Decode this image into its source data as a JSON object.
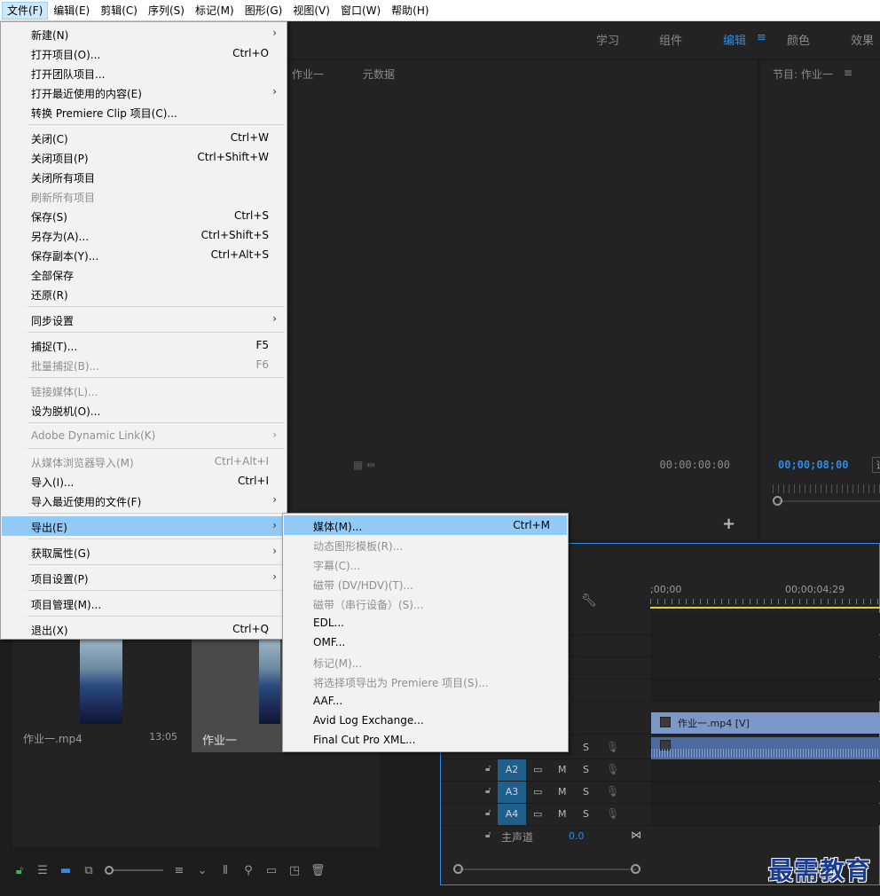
{
  "menubar": {
    "items": [
      "文件(F)",
      "编辑(E)",
      "剪辑(C)",
      "序列(S)",
      "标记(M)",
      "图形(G)",
      "视图(V)",
      "窗口(W)",
      "帮助(H)"
    ]
  },
  "workspace": {
    "tabs": [
      "学习",
      "组件",
      "编辑",
      "颜色",
      "效果"
    ],
    "active_tab": "编辑",
    "menu_icon": "≡"
  },
  "source_panel": {
    "tabs": [
      "作业一",
      "元数据"
    ],
    "timecode": "00:00:00:00"
  },
  "program_panel": {
    "title": "节目: 作业一",
    "menu_icon": "≡",
    "timecode": "00;00;08;00"
  },
  "project_panel": {
    "items": [
      {
        "name": "作业一.mp4",
        "duration": "13;05"
      },
      {
        "name": "作业一",
        "duration": ""
      }
    ]
  },
  "timeline": {
    "ruler_labels": [
      ";00;00",
      "00;00;04;29"
    ],
    "video_clip": "作业一.mp4 [V]",
    "audio_tracks": [
      {
        "name": "A2",
        "m": "M",
        "s": "S"
      },
      {
        "name": "A3",
        "m": "M",
        "s": "S"
      },
      {
        "name": "A4",
        "m": "M",
        "s": "S"
      }
    ],
    "a1_s": "S",
    "master_label": "主声道",
    "master_value": "0.0"
  },
  "file_menu": {
    "items": [
      {
        "label": "新建(N)",
        "shortcut": "",
        "submenu": true,
        "disabled": false
      },
      {
        "label": "打开项目(O)...",
        "shortcut": "Ctrl+O",
        "submenu": false,
        "disabled": false
      },
      {
        "label": "打开团队项目...",
        "shortcut": "",
        "submenu": false,
        "disabled": false
      },
      {
        "label": "打开最近使用的内容(E)",
        "shortcut": "",
        "submenu": true,
        "disabled": false
      },
      {
        "label": "转换 Premiere Clip 项目(C)...",
        "shortcut": "",
        "submenu": false,
        "disabled": false
      },
      {
        "label": "关闭(C)",
        "shortcut": "Ctrl+W",
        "submenu": false,
        "disabled": false
      },
      {
        "label": "关闭项目(P)",
        "shortcut": "Ctrl+Shift+W",
        "submenu": false,
        "disabled": false
      },
      {
        "label": "关闭所有项目",
        "shortcut": "",
        "submenu": false,
        "disabled": false
      },
      {
        "label": "刷新所有项目",
        "shortcut": "",
        "submenu": false,
        "disabled": true
      },
      {
        "label": "保存(S)",
        "shortcut": "Ctrl+S",
        "submenu": false,
        "disabled": false
      },
      {
        "label": "另存为(A)...",
        "shortcut": "Ctrl+Shift+S",
        "submenu": false,
        "disabled": false
      },
      {
        "label": "保存副本(Y)...",
        "shortcut": "Ctrl+Alt+S",
        "submenu": false,
        "disabled": false
      },
      {
        "label": "全部保存",
        "shortcut": "",
        "submenu": false,
        "disabled": false
      },
      {
        "label": "还原(R)",
        "shortcut": "",
        "submenu": false,
        "disabled": false
      },
      {
        "label": "同步设置",
        "shortcut": "",
        "submenu": true,
        "disabled": false
      },
      {
        "label": "捕捉(T)...",
        "shortcut": "F5",
        "submenu": false,
        "disabled": false
      },
      {
        "label": "批量捕捉(B)...",
        "shortcut": "F6",
        "submenu": false,
        "disabled": true
      },
      {
        "label": "链接媒体(L)...",
        "shortcut": "",
        "submenu": false,
        "disabled": true
      },
      {
        "label": "设为脱机(O)...",
        "shortcut": "",
        "submenu": false,
        "disabled": false
      },
      {
        "label": "Adobe Dynamic Link(K)",
        "shortcut": "",
        "submenu": true,
        "disabled": true
      },
      {
        "label": "从媒体浏览器导入(M)",
        "shortcut": "Ctrl+Alt+I",
        "submenu": false,
        "disabled": true
      },
      {
        "label": "导入(I)...",
        "shortcut": "Ctrl+I",
        "submenu": false,
        "disabled": false
      },
      {
        "label": "导入最近使用的文件(F)",
        "shortcut": "",
        "submenu": true,
        "disabled": false
      },
      {
        "label": "导出(E)",
        "shortcut": "",
        "submenu": true,
        "disabled": false,
        "highlight": true
      },
      {
        "label": "获取属性(G)",
        "shortcut": "",
        "submenu": true,
        "disabled": false
      },
      {
        "label": "项目设置(P)",
        "shortcut": "",
        "submenu": true,
        "disabled": false
      },
      {
        "label": "项目管理(M)...",
        "shortcut": "",
        "submenu": false,
        "disabled": false
      },
      {
        "label": "退出(X)",
        "shortcut": "Ctrl+Q",
        "submenu": false,
        "disabled": false
      }
    ]
  },
  "export_menu": {
    "items": [
      {
        "label": "媒体(M)...",
        "shortcut": "Ctrl+M",
        "disabled": false,
        "highlight": true
      },
      {
        "label": "动态图形模板(R)...",
        "shortcut": "",
        "disabled": true
      },
      {
        "label": "字幕(C)...",
        "shortcut": "",
        "disabled": true
      },
      {
        "label": "磁带 (DV/HDV)(T)...",
        "shortcut": "",
        "disabled": true
      },
      {
        "label": "磁带（串行设备）(S)...",
        "shortcut": "",
        "disabled": true
      },
      {
        "label": "EDL...",
        "shortcut": "",
        "disabled": false
      },
      {
        "label": "OMF...",
        "shortcut": "",
        "disabled": false
      },
      {
        "label": "标记(M)...",
        "shortcut": "",
        "disabled": true
      },
      {
        "label": "将选择项导出为 Premiere 项目(S)...",
        "shortcut": "",
        "disabled": true
      },
      {
        "label": "AAF...",
        "shortcut": "",
        "disabled": false
      },
      {
        "label": "Avid Log Exchange...",
        "shortcut": "",
        "disabled": false
      },
      {
        "label": "Final Cut Pro XML...",
        "shortcut": "",
        "disabled": false
      }
    ]
  },
  "watermark": "最需教育",
  "colors": {
    "accent_blue": "#2d8ceb",
    "menu_highlight": "#91c9f7",
    "timeline_yellow": "#e6d51f",
    "video_clip": "#7c98c9"
  }
}
